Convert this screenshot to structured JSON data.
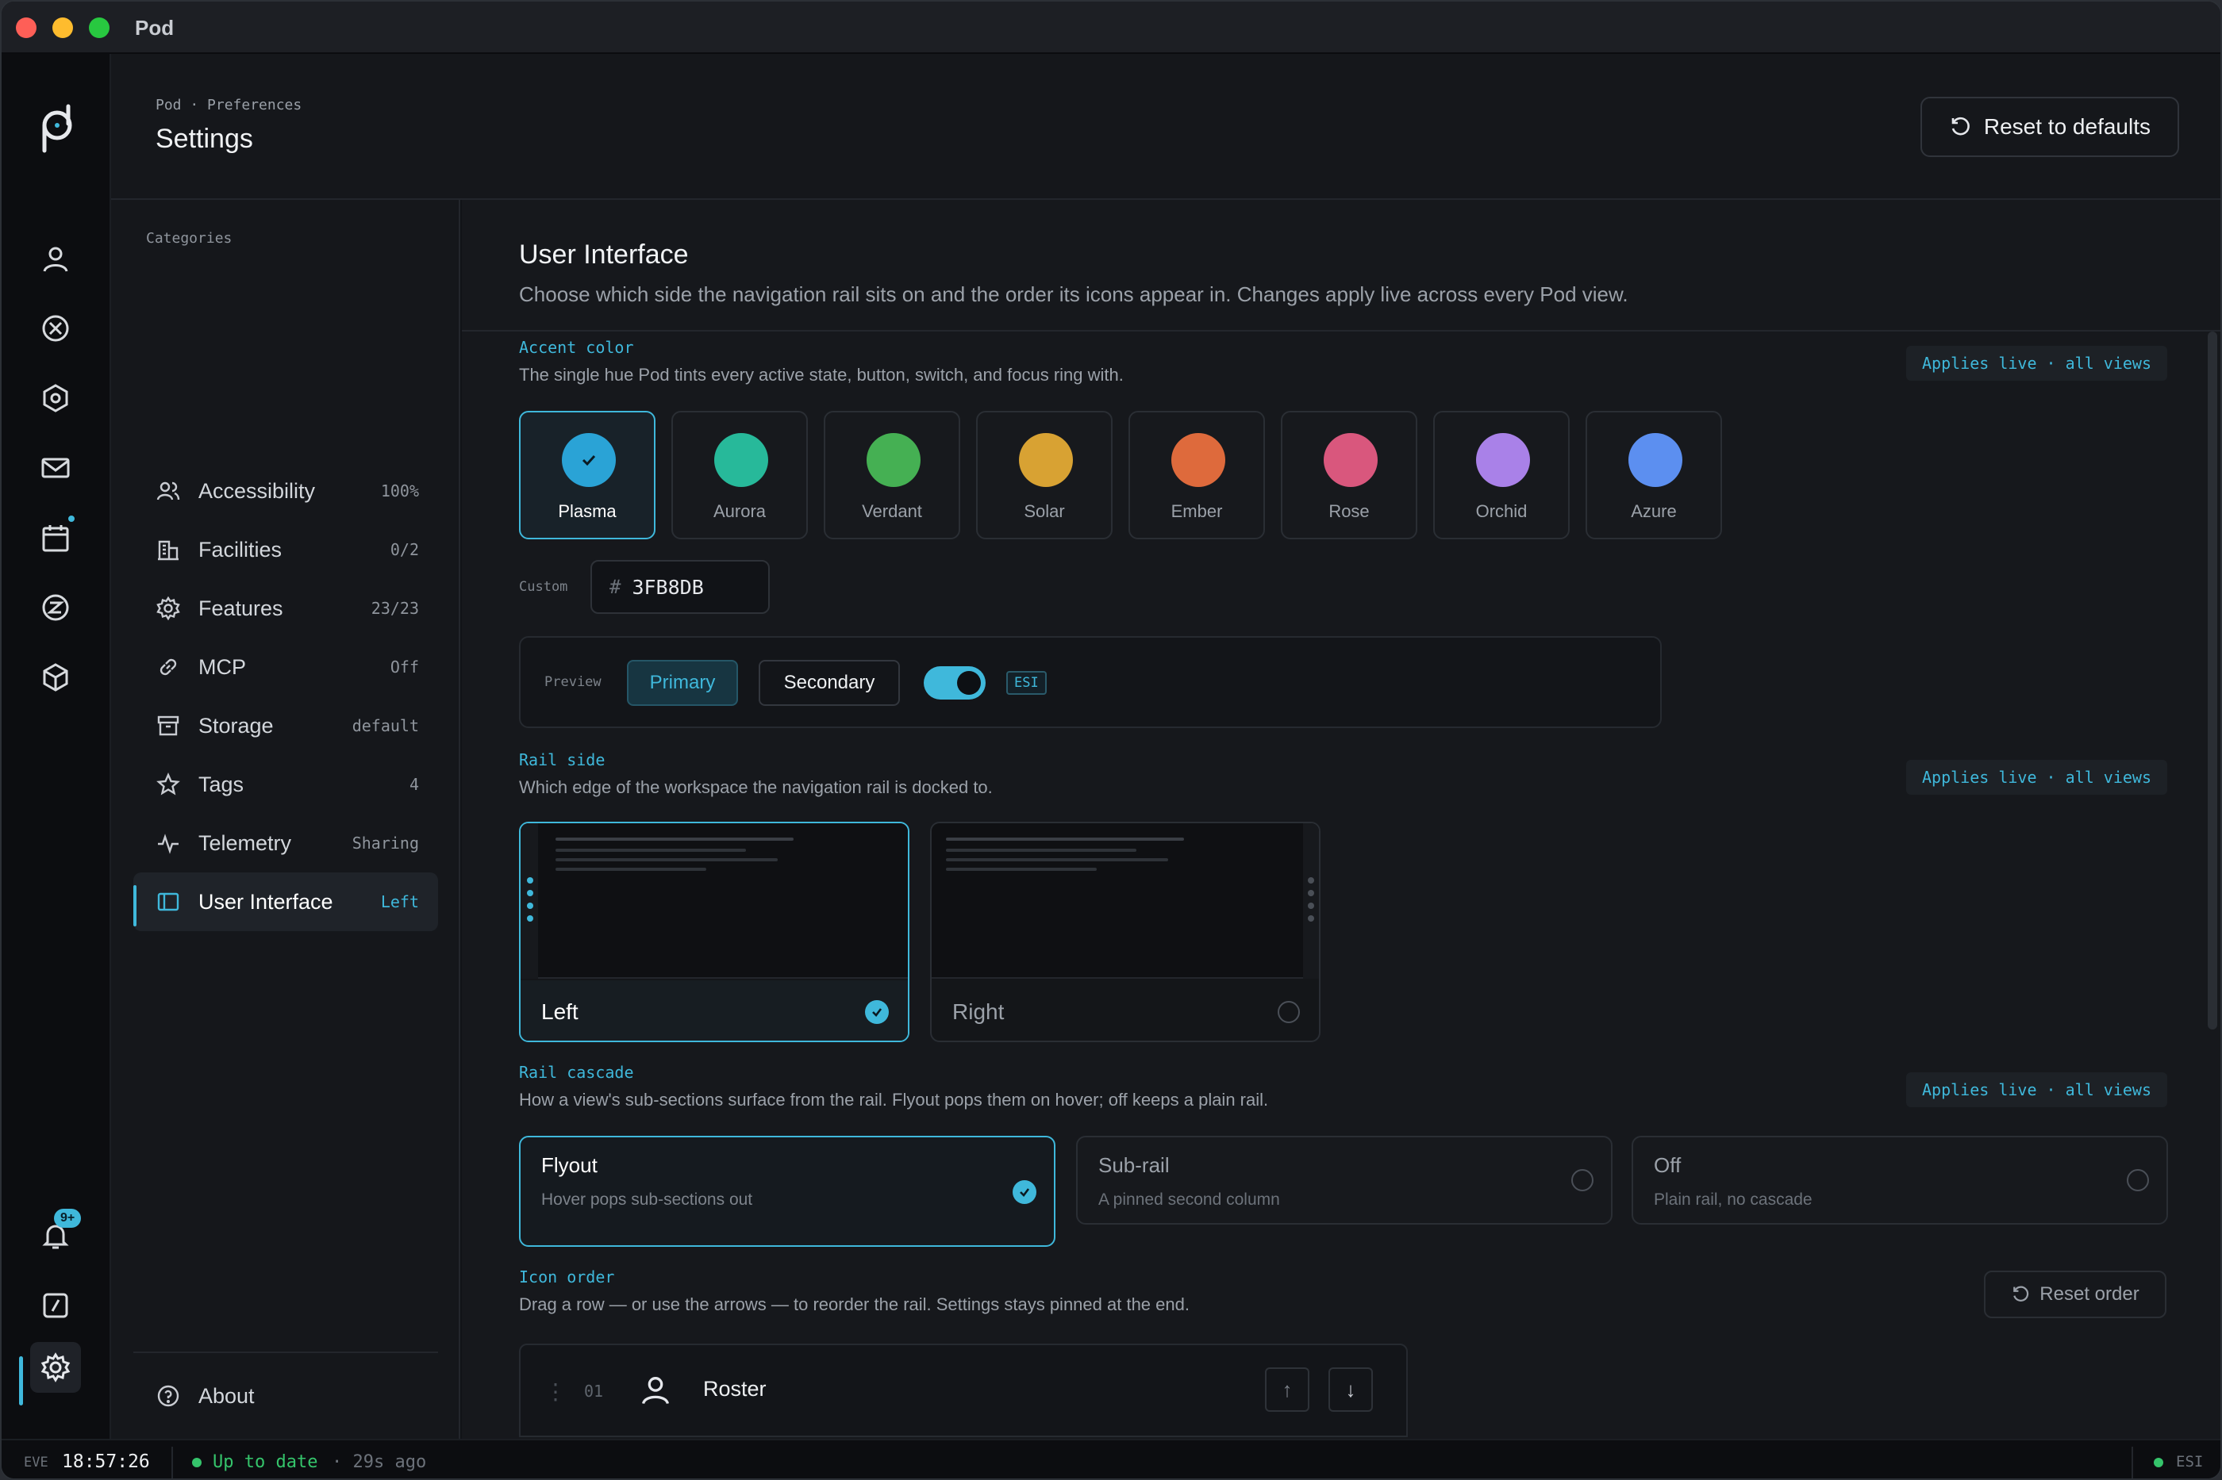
{
  "window": {
    "title": "Pod"
  },
  "header": {
    "breadcrumb": "Pod · Preferences",
    "title": "Settings",
    "reset_label": "Reset to defaults"
  },
  "rail": {
    "items": [
      {
        "icon": "user-icon"
      },
      {
        "icon": "circle-x-icon"
      },
      {
        "icon": "hexagon-icon"
      },
      {
        "icon": "mail-icon"
      },
      {
        "icon": "calendar-icon"
      },
      {
        "icon": "z-circle-icon"
      },
      {
        "icon": "cube-icon"
      }
    ],
    "bottom": [
      {
        "icon": "bell-icon",
        "badge": "9+"
      },
      {
        "icon": "slash-square-icon"
      },
      {
        "icon": "gear-icon"
      }
    ]
  },
  "categories": {
    "title": "Categories",
    "items": [
      {
        "label": "Accessibility",
        "value": "100%"
      },
      {
        "label": "Facilities",
        "value": "0/2"
      },
      {
        "label": "Features",
        "value": "23/23"
      },
      {
        "label": "MCP",
        "value": "Off"
      },
      {
        "label": "Storage",
        "value": "default"
      },
      {
        "label": "Tags",
        "value": "4"
      },
      {
        "label": "Telemetry",
        "value": "Sharing"
      },
      {
        "label": "User Interface",
        "value": "Left"
      }
    ],
    "about": "About"
  },
  "main": {
    "title": "User Interface",
    "description": "Choose which side the navigation rail sits on and the order its icons appear in. Changes apply live across every Pod view.",
    "applies_live": "Applies live · all views",
    "accent": {
      "label": "Accent color",
      "description": "The single hue Pod tints every active state, button, switch, and focus ring with.",
      "swatches": [
        {
          "name": "Plasma",
          "color": "#2aa3d6",
          "selected": true
        },
        {
          "name": "Aurora",
          "color": "#27b99a"
        },
        {
          "name": "Verdant",
          "color": "#45b053"
        },
        {
          "name": "Solar",
          "color": "#d8a233"
        },
        {
          "name": "Ember",
          "color": "#de6a3c"
        },
        {
          "name": "Rose",
          "color": "#d9577d"
        },
        {
          "name": "Orchid",
          "color": "#a981e8"
        },
        {
          "name": "Azure",
          "color": "#5c8ff0"
        }
      ],
      "custom_label": "Custom",
      "custom_hash": "#",
      "custom_value": "3FB8DB"
    },
    "preview": {
      "label": "Preview",
      "primary": "Primary",
      "secondary": "Secondary",
      "toggle_on": true,
      "chip": "ESI"
    },
    "rail_side": {
      "label": "Rail side",
      "description": "Which edge of the workspace the navigation rail is docked to.",
      "options": [
        {
          "label": "Left",
          "selected": true
        },
        {
          "label": "Right",
          "selected": false
        }
      ]
    },
    "rail_cascade": {
      "label": "Rail cascade",
      "description": "How a view's sub-sections surface from the rail. Flyout pops them on hover; off keeps a plain rail.",
      "options": [
        {
          "title": "Flyout",
          "desc": "Hover pops sub-sections out",
          "selected": true
        },
        {
          "title": "Sub-rail",
          "desc": "A pinned second column",
          "selected": false
        },
        {
          "title": "Off",
          "desc": "Plain rail, no cascade",
          "selected": false
        }
      ]
    },
    "icon_order": {
      "label": "Icon order",
      "description": "Drag a row — or use the arrows — to reorder the rail. Settings stays pinned at the end.",
      "reset_label": "Reset order",
      "rows": [
        {
          "num": "01",
          "name": "Roster",
          "icon": "user-icon"
        }
      ],
      "up_arrow": "↑",
      "down_arrow": "↓"
    }
  },
  "status": {
    "tz": "EVE",
    "time": "18:57:26",
    "state": "Up to date",
    "ago": "· 29s ago",
    "right_label": "ESI"
  },
  "colors": {
    "accent": "#3fb8db",
    "ok": "#35c46b"
  }
}
